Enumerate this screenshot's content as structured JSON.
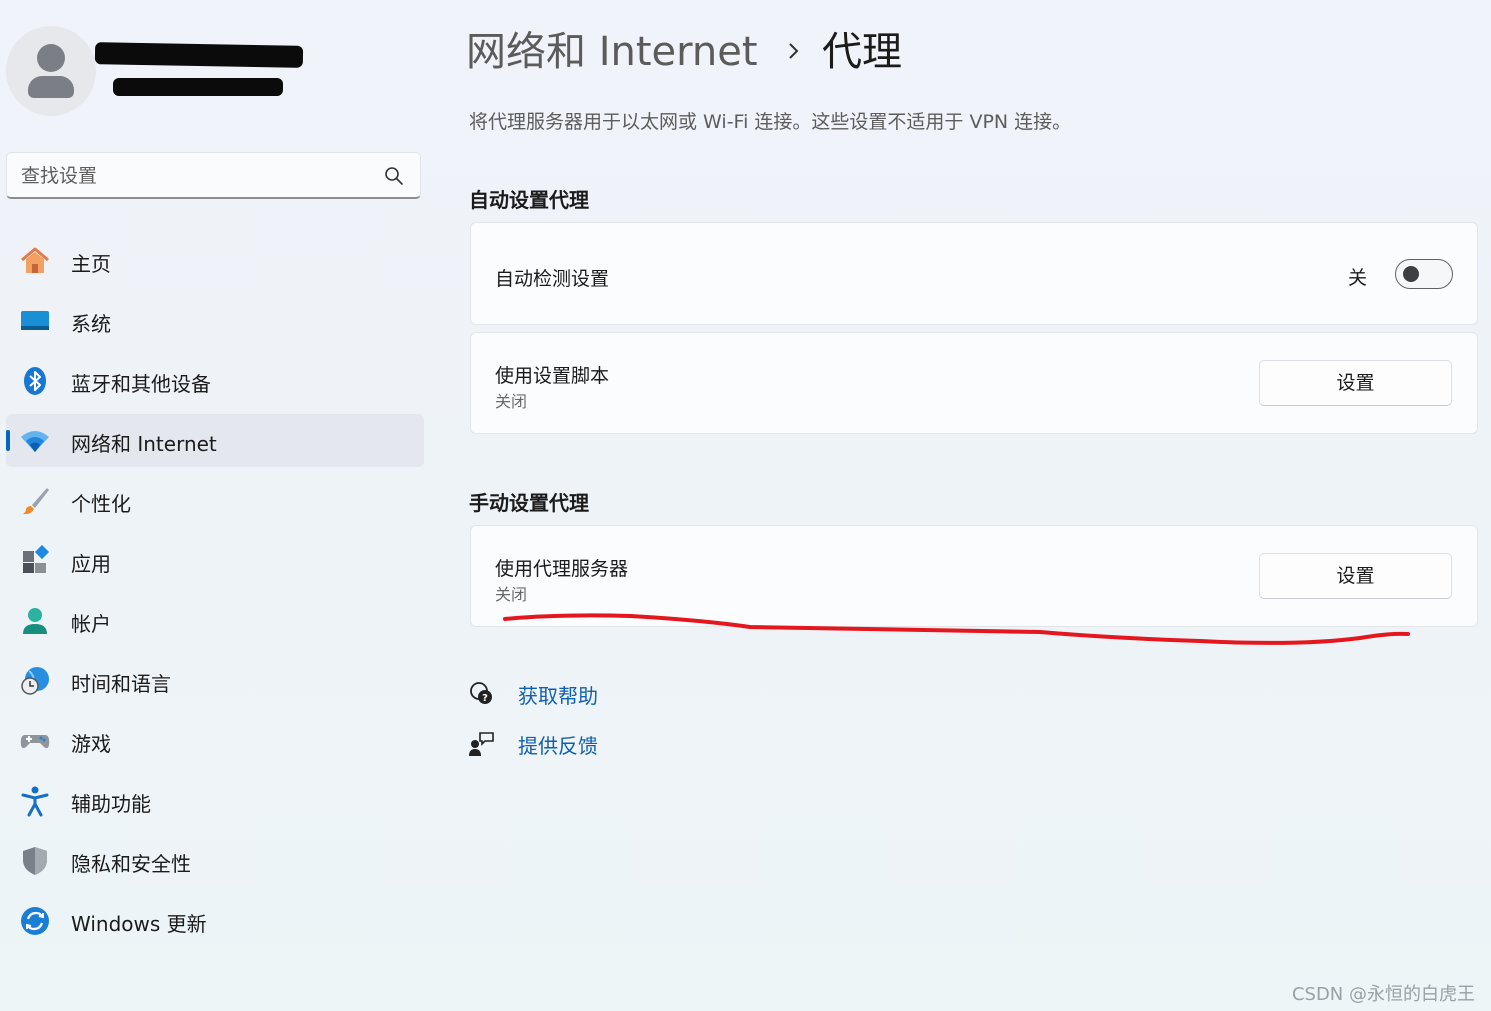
{
  "profile": {
    "avatar_icon": "user-avatar-icon"
  },
  "search": {
    "placeholder": "查找设置",
    "icon": "search-icon"
  },
  "sidebar": {
    "items": [
      {
        "label": "主页",
        "icon": "home-icon"
      },
      {
        "label": "系统",
        "icon": "system-icon"
      },
      {
        "label": "蓝牙和其他设备",
        "icon": "bluetooth-icon"
      },
      {
        "label": "网络和 Internet",
        "icon": "wifi-icon",
        "active": true
      },
      {
        "label": "个性化",
        "icon": "brush-icon"
      },
      {
        "label": "应用",
        "icon": "apps-icon"
      },
      {
        "label": "帐户",
        "icon": "account-icon"
      },
      {
        "label": "时间和语言",
        "icon": "globe-clock-icon"
      },
      {
        "label": "游戏",
        "icon": "gamepad-icon"
      },
      {
        "label": "辅助功能",
        "icon": "accessibility-icon"
      },
      {
        "label": "隐私和安全性",
        "icon": "shield-icon"
      },
      {
        "label": "Windows 更新",
        "icon": "update-icon"
      }
    ]
  },
  "breadcrumb": {
    "parent": "网络和 Internet",
    "separator_icon": "chevron-right-icon",
    "current": "代理"
  },
  "description": "将代理服务器用于以太网或 Wi-Fi 连接。这些设置不适用于 VPN 连接。",
  "auto_section": {
    "title": "自动设置代理",
    "detect": {
      "title": "自动检测设置",
      "state_label": "关",
      "enabled": false
    },
    "script": {
      "title": "使用设置脚本",
      "subtitle": "关闭",
      "button": "设置"
    }
  },
  "manual_section": {
    "title": "手动设置代理",
    "proxy": {
      "title": "使用代理服务器",
      "subtitle": "关闭",
      "button": "设置"
    }
  },
  "links": {
    "help": {
      "label": "获取帮助",
      "icon": "help-chat-icon"
    },
    "feedback": {
      "label": "提供反馈",
      "icon": "feedback-icon"
    }
  },
  "annotation": {
    "color": "#e3171d"
  },
  "watermark": "CSDN @永恒的白虎王",
  "colors": {
    "accent": "#0067c0",
    "link": "#0f5fb2"
  }
}
